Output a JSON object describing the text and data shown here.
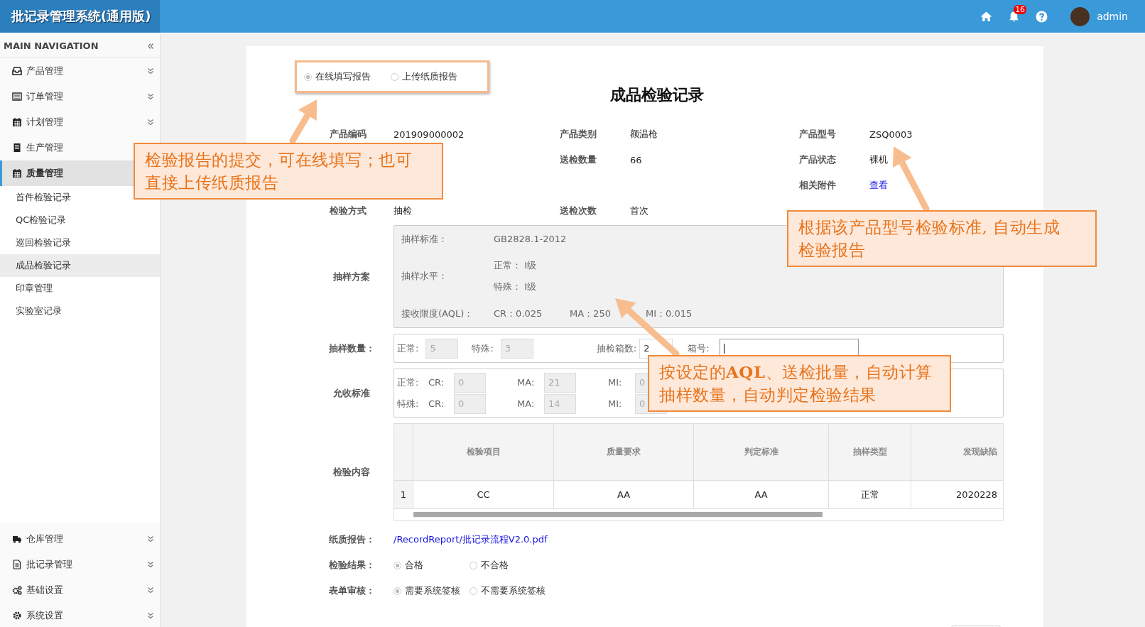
{
  "header": {
    "title": "批记录管理系统(通用版)",
    "notification_count": "16",
    "user": "admin"
  },
  "sidebar": {
    "heading": "MAIN NAVIGATION",
    "top_items": [
      {
        "label": "产品管理",
        "expandable": true,
        "selected": false
      },
      {
        "label": "订单管理",
        "expandable": true,
        "selected": false
      },
      {
        "label": "计划管理",
        "expandable": true,
        "selected": false
      },
      {
        "label": "生产管理",
        "selected": false
      },
      {
        "label": "质量管理",
        "selected": true,
        "children": [
          {
            "label": "首件检验记录",
            "selected": false
          },
          {
            "label": "QC检验记录",
            "selected": false
          },
          {
            "label": "巡回检验记录",
            "selected": false
          },
          {
            "label": "成品检验记录",
            "selected": true
          },
          {
            "label": "印章管理",
            "selected": false
          },
          {
            "label": "实验室记录",
            "selected": false
          }
        ]
      }
    ],
    "bottom_items": [
      {
        "label": "仓库管理",
        "expandable": true
      },
      {
        "label": "批记录管理",
        "expandable": true
      },
      {
        "label": "基础设置",
        "expandable": true
      },
      {
        "label": "系统设置",
        "expandable": true
      }
    ]
  },
  "report_mode": [
    {
      "label": "在线填写报告",
      "selected": true
    },
    {
      "label": "上传纸质报告",
      "selected": false
    }
  ],
  "title": "成品检验记录",
  "info_rows": [
    [
      {
        "label": "产品编码",
        "value": "201909000002",
        "kind": "text"
      },
      {
        "label": "产品类别",
        "value": "额温枪",
        "kind": "text"
      },
      {
        "label": "产品型号",
        "value": "ZSQ0003",
        "kind": "text"
      }
    ],
    [
      null,
      {
        "label": "送检数量",
        "value": "66",
        "kind": "text"
      },
      {
        "label": "产品状态",
        "value": "裸机",
        "kind": "text"
      }
    ],
    [
      null,
      null,
      {
        "label": "相关附件",
        "value": "查看",
        "kind": "link"
      }
    ],
    [
      {
        "label": "检验方式",
        "value": "抽检",
        "kind": "text"
      },
      {
        "label": "送检次数",
        "value": "首次",
        "kind": "text"
      },
      null
    ]
  ],
  "sampling_plan": {
    "label": "抽样方案",
    "standard_label": "抽样标准：",
    "standard": "GB2828.1-2012",
    "level_label": "抽样水平：",
    "levels": [
      "正常： I级",
      "特殊： I级"
    ],
    "aql_label": "接收限度(AQL)：",
    "aql": [
      "CR：0.025",
      "MA：250",
      "MI：0.015"
    ]
  },
  "sample_quantity": {
    "label": "抽样数量：",
    "fields": [
      {
        "label": "正常:",
        "value": "5",
        "disabled": true
      },
      {
        "label": "特殊:",
        "value": "3",
        "disabled": true
      },
      {
        "label": "抽检箱数:",
        "value": "2",
        "disabled": false
      },
      {
        "label": "箱号:",
        "disabled": false
      }
    ]
  },
  "acceptance": {
    "label": "允收标准",
    "rows": [
      {
        "type": "正常:",
        "cells": [
          {
            "label": "CR:",
            "value": "0"
          },
          {
            "label": "MA:",
            "value": "21"
          },
          {
            "label": "MI:",
            "value": "0"
          }
        ]
      },
      {
        "type": "特殊:",
        "cells": [
          {
            "label": "CR:",
            "value": "0"
          },
          {
            "label": "MA:",
            "value": "14"
          },
          {
            "label": "MI:",
            "value": "0"
          }
        ]
      }
    ]
  },
  "content": {
    "label": "检验内容",
    "columns": [
      "检验项目",
      "质量要求",
      "判定标准",
      "抽样类型",
      "发现缺陷"
    ],
    "rows": [
      {
        "index": "1",
        "cells": [
          "CC",
          "AA",
          "AA",
          "正常",
          "2020228"
        ]
      }
    ]
  },
  "paper_report": {
    "label": "纸质报告：",
    "link": "/RecordReport/批记录流程V2.0.pdf"
  },
  "result": {
    "label": "检验结果：",
    "options": [
      {
        "label": "合格",
        "selected": true
      },
      {
        "label": "不合格",
        "selected": false
      }
    ]
  },
  "review": {
    "label": "表单审核：",
    "options": [
      {
        "label": "需要系统签核",
        "selected": true
      },
      {
        "label": "不需要系统签核",
        "selected": false
      }
    ]
  },
  "callouts": [
    {
      "text": "检验报告的提交，可在线填写；也可直接上传纸质报告"
    },
    {
      "text": "根据该产品型号检验标准, 自动生成检验报告"
    },
    {
      "text": "按设定的**AQL**、送检批量，自动计算抽样数量，自动判定检验结果"
    }
  ]
}
